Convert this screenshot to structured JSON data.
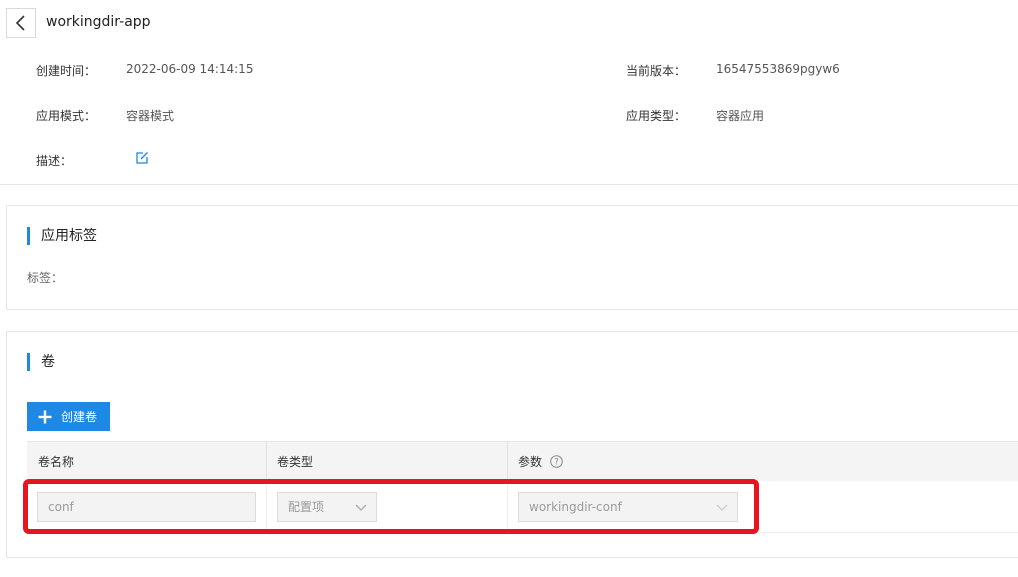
{
  "header": {
    "app_name": "workingdir-app",
    "created_label": "创建时间：",
    "created_value": "2022-06-09 14:14:15",
    "version_label": "当前版本：",
    "version_value": "16547553869pgyw6",
    "mode_label": "应用模式：",
    "mode_value": "容器模式",
    "type_label": "应用类型：",
    "type_value": "容器应用",
    "desc_label": "描述："
  },
  "labels_section": {
    "title": "应用标签",
    "tags_label": "标签："
  },
  "volumes_section": {
    "title": "卷",
    "create_button": "创建卷",
    "columns": [
      "卷名称",
      "卷类型",
      "参数"
    ],
    "rows": [
      {
        "name": "conf",
        "type": "配置项",
        "param": "workingdir-conf"
      }
    ]
  },
  "colors": {
    "accent": "#1e88e5",
    "highlight": "#e8141e"
  }
}
